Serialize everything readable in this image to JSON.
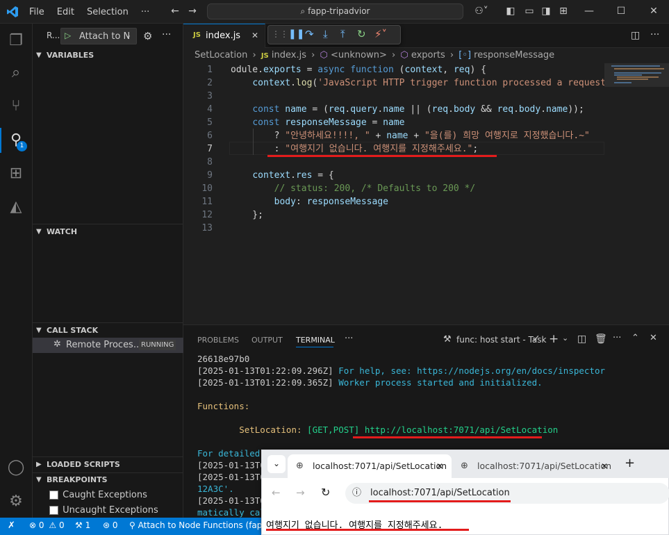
{
  "titlebar": {
    "menu": [
      "File",
      "Edit",
      "Selection",
      "···"
    ],
    "search": "fapp-tripadvior"
  },
  "sidebar": {
    "run_label": "R...",
    "launch_config": "Attach to N",
    "sections": {
      "variables": "VARIABLES",
      "watch": "WATCH",
      "call_stack": "CALL STACK",
      "loaded_scripts": "LOADED SCRIPTS",
      "breakpoints": "BREAKPOINTS"
    },
    "call_stack_item": "Remote Proces...",
    "call_stack_status": "RUNNING",
    "breakpoints": [
      "Caught Exceptions",
      "Uncaught Exceptions"
    ],
    "debug_badge": "1"
  },
  "editor": {
    "tab": "index.js",
    "breadcrumb": [
      "SetLocation",
      "index.js",
      "<unknown>",
      "exports",
      "responseMessage"
    ],
    "lines": [
      {
        "n": "1",
        "parts": [
          [
            "op",
            "odule."
          ],
          [
            "var",
            "exports"
          ],
          [
            "op",
            " = "
          ],
          [
            "kw",
            "async"
          ],
          [
            "op",
            " "
          ],
          [
            "kw",
            "function"
          ],
          [
            "op",
            " ("
          ],
          [
            "var",
            "context"
          ],
          [
            "op",
            ", "
          ],
          [
            "var",
            "req"
          ],
          [
            "op",
            ") {"
          ]
        ]
      },
      {
        "n": "2",
        "parts": [
          [
            "op",
            "    "
          ],
          [
            "var",
            "context"
          ],
          [
            "op",
            "."
          ],
          [
            "fn",
            "log"
          ],
          [
            "op",
            "("
          ],
          [
            "str",
            "'JavaScript HTTP trigger function processed a request.'"
          ]
        ]
      },
      {
        "n": "3",
        "parts": []
      },
      {
        "n": "4",
        "parts": [
          [
            "op",
            "    "
          ],
          [
            "kw",
            "const"
          ],
          [
            "op",
            " "
          ],
          [
            "var",
            "name"
          ],
          [
            "op",
            " = ("
          ],
          [
            "var",
            "req"
          ],
          [
            "op",
            "."
          ],
          [
            "var",
            "query"
          ],
          [
            "op",
            "."
          ],
          [
            "var",
            "name"
          ],
          [
            "op",
            " || ("
          ],
          [
            "var",
            "req"
          ],
          [
            "op",
            "."
          ],
          [
            "var",
            "body"
          ],
          [
            "op",
            " && "
          ],
          [
            "var",
            "req"
          ],
          [
            "op",
            "."
          ],
          [
            "var",
            "body"
          ],
          [
            "op",
            "."
          ],
          [
            "var",
            "name"
          ],
          [
            "op",
            "));"
          ]
        ]
      },
      {
        "n": "5",
        "parts": [
          [
            "op",
            "    "
          ],
          [
            "kw",
            "const"
          ],
          [
            "op",
            " "
          ],
          [
            "var",
            "responseMessage"
          ],
          [
            "op",
            " = "
          ],
          [
            "var",
            "name"
          ]
        ]
      },
      {
        "n": "6",
        "parts": [
          [
            "op",
            "        ? "
          ],
          [
            "str",
            "\"안녕하세요!!!!, \""
          ],
          [
            "op",
            " + "
          ],
          [
            "var",
            "name"
          ],
          [
            "op",
            " + "
          ],
          [
            "str",
            "\"을(를) 희망 여행지로 지정했습니다.~\""
          ]
        ]
      },
      {
        "n": "7",
        "parts": [
          [
            "op",
            "        : "
          ],
          [
            "str",
            "\"여행지기 없습니다. 여행지를 지정해주세요.\""
          ],
          [
            "op",
            ";"
          ]
        ]
      },
      {
        "n": "8",
        "parts": []
      },
      {
        "n": "9",
        "parts": [
          [
            "op",
            "    "
          ],
          [
            "var",
            "context"
          ],
          [
            "op",
            "."
          ],
          [
            "var",
            "res"
          ],
          [
            "op",
            " = {"
          ]
        ]
      },
      {
        "n": "10",
        "parts": [
          [
            "op",
            "        "
          ],
          [
            "cm",
            "// status: 200, /* Defaults to 200 */"
          ]
        ]
      },
      {
        "n": "11",
        "parts": [
          [
            "op",
            "        "
          ],
          [
            "var",
            "body"
          ],
          [
            "op",
            ": "
          ],
          [
            "var",
            "responseMessage"
          ]
        ]
      },
      {
        "n": "12",
        "parts": [
          [
            "op",
            "    };"
          ]
        ]
      },
      {
        "n": "13",
        "parts": []
      }
    ]
  },
  "panel": {
    "tabs": [
      "PROBLEMS",
      "OUTPUT",
      "TERMINAL",
      "···"
    ],
    "task": "func: host start - Task",
    "lines": [
      {
        "parts": [
          [
            "",
            "26618e97b0"
          ]
        ]
      },
      {
        "parts": [
          [
            "",
            "[2025-01-13T01:22:09.296Z] "
          ],
          [
            "t-cyan",
            "For help, see: https://nodejs.org/en/docs/inspector"
          ]
        ]
      },
      {
        "parts": [
          [
            "",
            "[2025-01-13T01:22:09.365Z] "
          ],
          [
            "t-cyan",
            "Worker process started and initialized."
          ]
        ]
      },
      {
        "parts": []
      },
      {
        "parts": [
          [
            "t-yellow",
            "Functions:"
          ]
        ]
      },
      {
        "parts": []
      },
      {
        "parts": [
          [
            "t-yellow",
            "        SetLocation:"
          ],
          [
            "t-green",
            " [GET,POST] "
          ],
          [
            "t-green",
            "http://localhost:7071/api/SetLocation"
          ]
        ]
      },
      {
        "parts": []
      },
      {
        "parts": [
          [
            "t-cyan",
            "For detailed"
          ]
        ]
      },
      {
        "parts": [
          [
            "",
            "[2025-01-13T0"
          ]
        ]
      },
      {
        "parts": [
          [
            "",
            "[2025-01-13T0"
          ]
        ]
      },
      {
        "parts": [
          [
            "t-cyan",
            "12A3C'."
          ]
        ]
      },
      {
        "parts": [
          [
            "",
            "[2025-01-13T0"
          ]
        ]
      },
      {
        "parts": [
          [
            "t-cyan",
            "matically cal"
          ]
        ]
      }
    ]
  },
  "statusbar": {
    "errors": "0",
    "warnings": "0",
    "workers": "1",
    "ports": "0",
    "debug": "Attach to Node Functions (fapp-"
  },
  "browser": {
    "tab1": "localhost:7071/api/SetLocation",
    "tab2": "localhost:7071/api/SetLocation",
    "url": "localhost:7071/api/SetLocation",
    "body": "여행지기 없습니다. 여행지를 지정해주세요."
  },
  "colors": {
    "accent": "#0078d4",
    "highlight": "#e31c1c"
  }
}
